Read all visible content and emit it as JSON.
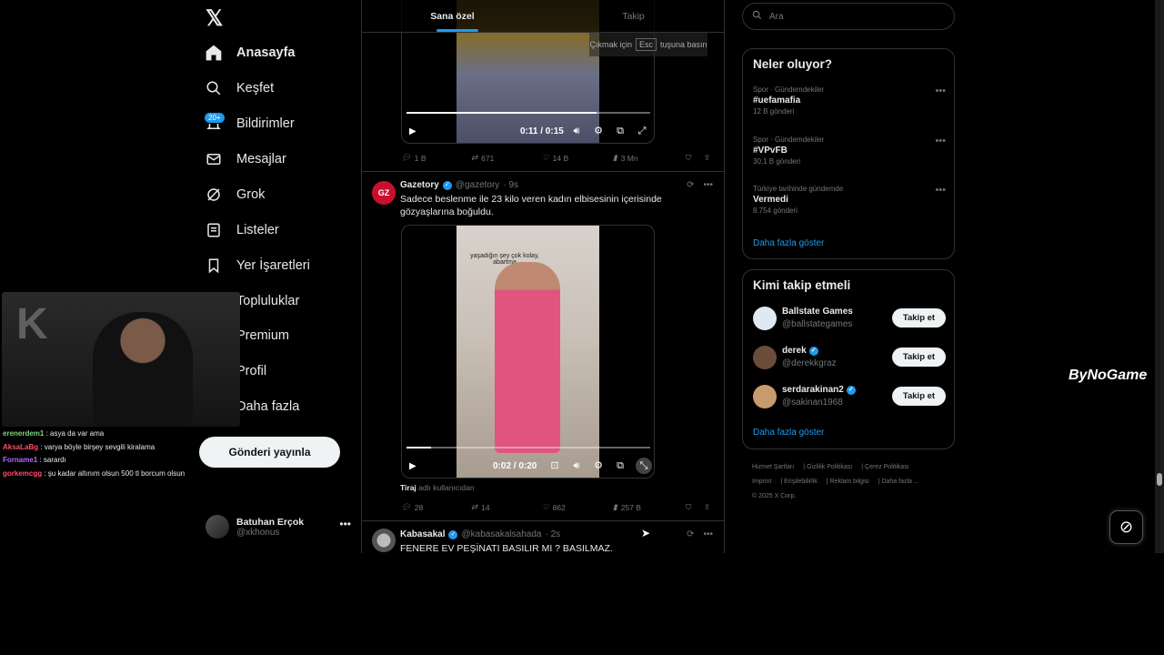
{
  "nav": {
    "items": [
      {
        "label": "Anasayfa",
        "icon": "home-icon",
        "active": true
      },
      {
        "label": "Keşfet",
        "icon": "search-icon"
      },
      {
        "label": "Bildirimler",
        "icon": "bell-icon",
        "badge": "20+"
      },
      {
        "label": "Mesajlar",
        "icon": "mail-icon"
      },
      {
        "label": "Grok",
        "icon": "grok-icon"
      },
      {
        "label": "Listeler",
        "icon": "list-icon"
      },
      {
        "label": "Yer İşaretleri",
        "icon": "bookmark-icon"
      },
      {
        "label": "Topluluklar",
        "icon": "people-icon"
      },
      {
        "label": "Premium",
        "icon": "x-icon"
      },
      {
        "label": "Profil",
        "icon": "person-icon"
      },
      {
        "label": "Daha fazla",
        "icon": "more-circle-icon"
      }
    ],
    "post_button": "Gönderi yayınla",
    "profile": {
      "name": "Batuhan Erçok",
      "handle": "@xkhonus"
    }
  },
  "chat": [
    {
      "user": "erenerdem1",
      "msg": ": asya da var ama",
      "color": "#7cd67c"
    },
    {
      "user": "AksaLaBg",
      "msg": ": varya böyle birşey sevgili kiralama",
      "color": "#ff4c6a"
    },
    {
      "user": "Forname1",
      "msg": ": sarardı",
      "color": "#b46cff"
    },
    {
      "user": "gorkemcgg",
      "msg": ": şu kadar altınım olsun 500 tl borcum olsun",
      "color": "#ff4c6a"
    }
  ],
  "feed": {
    "tabs": [
      "Sana özel",
      "Takip"
    ],
    "esc_hint": {
      "pre": "Çıkmak için",
      "key": "Esc",
      "post": "tuşuna basın"
    },
    "video1": {
      "time": "0:11 / 0:15",
      "progress": 0.78
    },
    "tweet1_actions": {
      "replies": "1 B",
      "reposts": "671",
      "likes": "14 B",
      "views": "3 Mn"
    },
    "tweet2": {
      "name": "Gazetory",
      "handle": "@gazetory",
      "time": "· 9s",
      "avatar_text": "GZ",
      "text": "Sadece beslenme ile 23 kilo veren kadın elbisesinin içerisinde gözyaşlarına boğuldu.",
      "video_overlay": "yaşadığın şey çok kolay, abartma",
      "video_time": "0:02 / 0:20",
      "progress": 0.1,
      "caption_user": "Tiraj",
      "caption_rest": "adlı kullanıcıdan",
      "replies": "28",
      "reposts": "14",
      "likes": "862",
      "views": "257 B"
    },
    "tweet3": {
      "name": "Kabasakal",
      "handle": "@kabasakalsahada",
      "time": "· 2s",
      "text": "FENERE EV PEŞİNATI BASILIR MI ? BASILMAZ."
    }
  },
  "right": {
    "search_placeholder": "Ara",
    "trends_title": "Neler oluyor?",
    "trends": [
      {
        "context": "Spor · Gündemdekiler",
        "name": "#uefamafia",
        "count": "12 B gönderi"
      },
      {
        "context": "Spor · Gündemdekiler",
        "name": "#VPvFB",
        "count": "30,1 B gönderi"
      },
      {
        "context": "Türkiye tarihinde gündemde",
        "name": "Vermedi",
        "count": "8.754 gönderi"
      }
    ],
    "show_more": "Daha fazla göster",
    "who_title": "Kimi takip etmeli",
    "who": [
      {
        "name": "Ballstate Games",
        "handle": "@ballstategames",
        "verified": false,
        "avatar_color": "#dfe8f3"
      },
      {
        "name": "derek",
        "handle": "@derekkgraz",
        "verified": true,
        "avatar_color": "#6b4b3a"
      },
      {
        "name": "serdarakinan2",
        "handle": "@sakinan1968",
        "verified": true,
        "avatar_color": "#c99a6e"
      }
    ],
    "follow_label": "Takip et",
    "footer": [
      "Hizmet Şartları",
      "Gizlilik Politikası",
      "Çerez Politikası",
      "Imprint",
      "Erişilebilirlik",
      "Reklam bilgisi",
      "Daha fazla ...",
      "© 2025 X Corp."
    ]
  },
  "overlay": {
    "streamer_logo": "ByNoGame"
  },
  "colors": {
    "accent": "#1d9bf0",
    "bg": "#000000",
    "border": "#2f3336",
    "muted": "#71767b"
  }
}
